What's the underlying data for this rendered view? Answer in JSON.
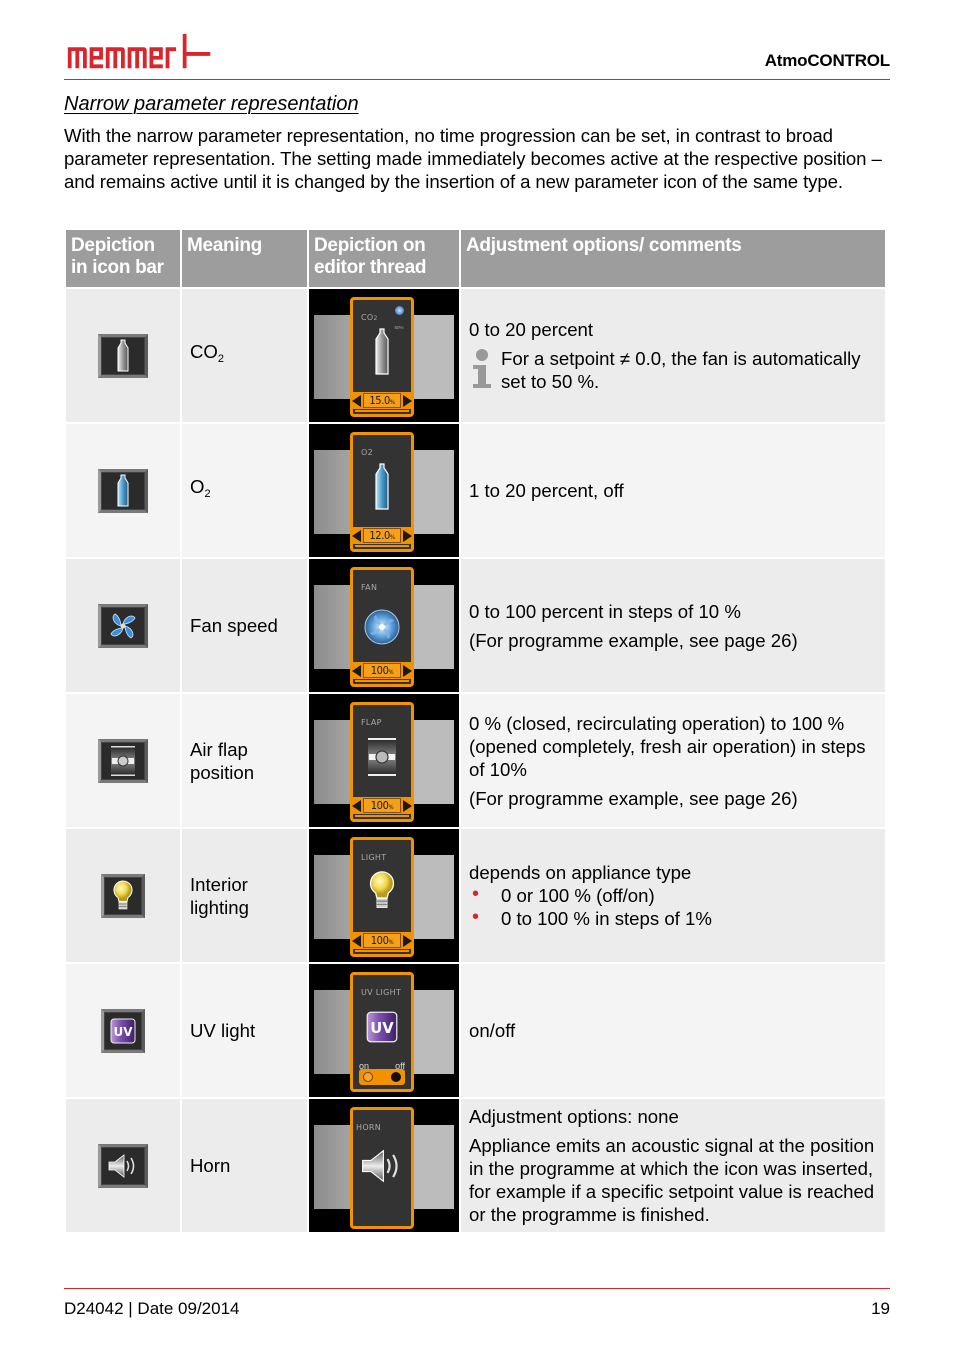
{
  "header": {
    "brand": "memmert",
    "product": "AtmoCONTROL",
    "brand_color": "#d9262c"
  },
  "section": {
    "title": "Narrow parameter representation",
    "intro": "With the narrow parameter representation, no time progression can be set, in contrast to broad parameter representation. The setting made immediately becomes active at the respective position – and remains active until it is changed by the insertion of a new parameter icon of the same type."
  },
  "table": {
    "headers": [
      "Depiction in icon bar",
      "Meaning",
      "Depiction on editor thread",
      "Adjustment options/ comments"
    ],
    "header_bg": "#9d9d9d",
    "accent_orange": "#f39200",
    "rows": [
      {
        "icon": "co2-cylinder-icon",
        "meaning": "CO",
        "meaning_sub": "2",
        "editor": {
          "title": "CO",
          "title_sub": "2",
          "fan_badge": "50%",
          "value": "15.0",
          "unit": "%"
        },
        "adj": {
          "line1": "0 to 20 percent",
          "note": "For a setpoint ≠ 0.0, the fan is automatically set to 50 %."
        }
      },
      {
        "icon": "o2-cylinder-icon",
        "meaning": "O",
        "meaning_sub": "2",
        "editor": {
          "title": "O2",
          "value": "12.0",
          "unit": "%"
        },
        "adj": {
          "line1": "1 to 20 percent, off"
        }
      },
      {
        "icon": "fan-icon",
        "meaning": "Fan speed",
        "editor": {
          "title": "FAN",
          "value": "100",
          "unit": "%"
        },
        "adj": {
          "line1": "0 to 100 percent in steps of 10 %",
          "line2": "(For programme example, see page 26)"
        }
      },
      {
        "icon": "air-flap-icon",
        "meaning": "Air flap position",
        "editor": {
          "title": "FLAP",
          "value": "100",
          "unit": "%"
        },
        "adj": {
          "line1": "0 % (closed, recirculating operation) to 100 % (opened completely, fresh air operation) in steps of 10%",
          "line2": "(For programme example, see page 26)"
        }
      },
      {
        "icon": "light-bulb-icon",
        "meaning": "Interior lighting",
        "editor": {
          "title": "LIGHT",
          "value": "100",
          "unit": "%"
        },
        "adj": {
          "line1": "depends on appliance type",
          "bullets": [
            "0 or 100 % (off/on)",
            "0 to 100 % in steps of 1%"
          ]
        }
      },
      {
        "icon": "uv-light-icon",
        "meaning": "UV light",
        "editor": {
          "title": "UV LIGHT",
          "badge": "UV",
          "on_label": "on",
          "off_label": "off",
          "state": "on"
        },
        "adj": {
          "line1": "on/off"
        }
      },
      {
        "icon": "horn-icon",
        "meaning": "Horn",
        "editor": {
          "title": "HORN"
        },
        "adj": {
          "line1": "Adjustment options: none",
          "line2": "Appliance emits an acoustic signal at the position in the programme at which the icon was inserted, for example if a specific setpoint value is reached or the programme is finished."
        }
      }
    ]
  },
  "footer": {
    "doc": "D24042 | Date 09/2014",
    "page": "19"
  }
}
